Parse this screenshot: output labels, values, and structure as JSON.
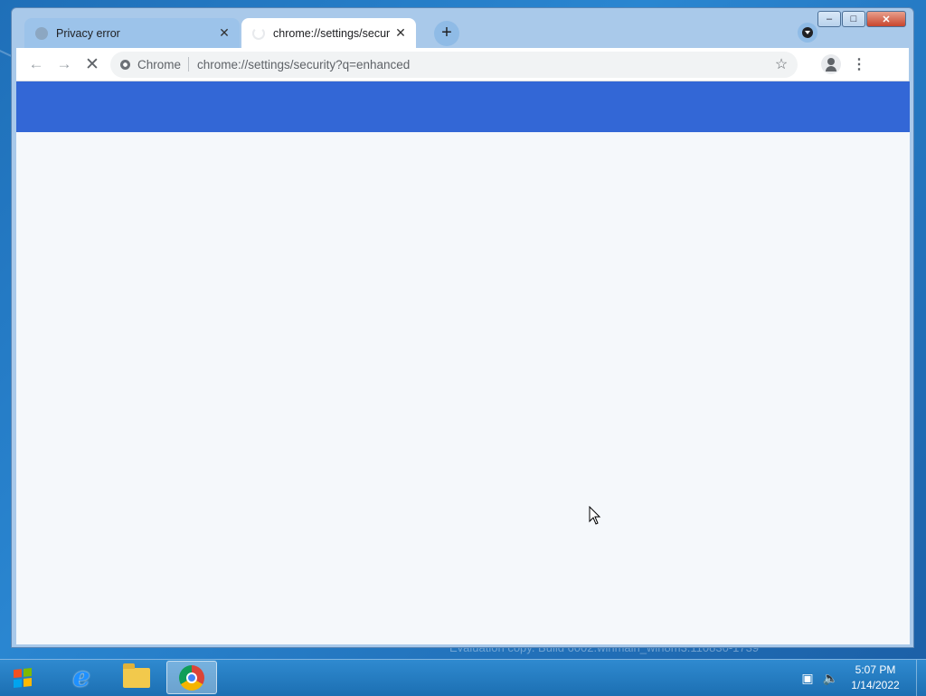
{
  "browser": {
    "tabs": [
      {
        "title": "Privacy error",
        "active": false
      },
      {
        "title": "chrome://settings/secur",
        "active": true
      }
    ],
    "new_tab_label": "+",
    "toolbar": {
      "site_chip_label": "Chrome",
      "url": "chrome://settings/security?q=enhanced"
    },
    "window_controls": {
      "minimize": "–",
      "maximize": "□",
      "close": "✕"
    },
    "content": {
      "header_color": "#3367d6",
      "background": "#f5f8fb"
    }
  },
  "taskbar": {
    "apps": [
      "internet-explorer",
      "file-explorer",
      "google-chrome"
    ],
    "clock_time": "5:07 PM",
    "clock_date": "1/14/2022"
  },
  "desktop": {
    "watermark": "Evaluation copy. Build 6002.winmain_win8m3.110830-1739"
  }
}
